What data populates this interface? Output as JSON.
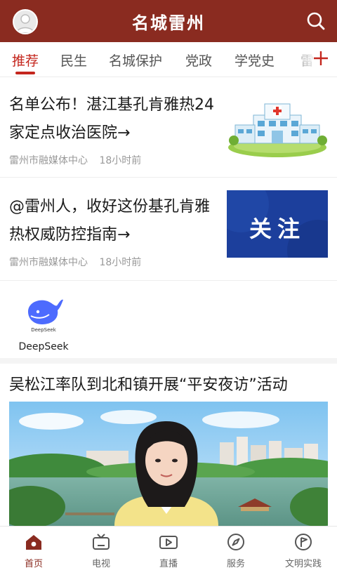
{
  "header": {
    "title": "名城雷州"
  },
  "tabs": [
    {
      "label": "推荐"
    },
    {
      "label": "民生"
    },
    {
      "label": "名城保护"
    },
    {
      "label": "党政"
    },
    {
      "label": "学党史"
    },
    {
      "label": "雷"
    }
  ],
  "feed": {
    "articles": [
      {
        "title": "名单公布！湛江基孔肯雅热24家定点收治医院→",
        "source": "雷州市融媒体中心",
        "time": "18小时前",
        "thumb_text": ""
      },
      {
        "title": "@雷州人，收好这份基孔肯雅热权威防控指南→",
        "source": "雷州市融媒体中心",
        "time": "18小时前",
        "thumb_text": "关注"
      }
    ],
    "mini_app": {
      "label": "DeepSeek",
      "icon_text": "DeepSeek"
    },
    "video": {
      "title": "吴松江率队到北和镇开展“平安夜访”活动"
    }
  },
  "bottom_nav": [
    {
      "label": "首页",
      "icon": "home-icon",
      "active": true
    },
    {
      "label": "电视",
      "icon": "tv-icon",
      "active": false
    },
    {
      "label": "直播",
      "icon": "live-icon",
      "active": false
    },
    {
      "label": "服务",
      "icon": "compass-icon",
      "active": false
    },
    {
      "label": "文明实践",
      "icon": "flag-icon",
      "active": false
    }
  ],
  "colors": {
    "brand": "#8a2b20",
    "accent": "#c4261d",
    "thumb_blue": "#1c3f9c"
  }
}
